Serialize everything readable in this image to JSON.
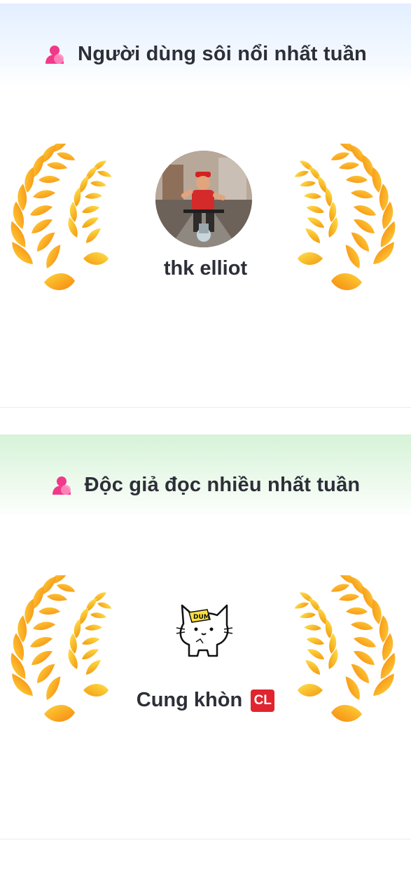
{
  "sections": [
    {
      "title": "Người dùng sôi nổi nhất tuần",
      "icon": "user-icon",
      "winner": {
        "name": "thk elliot",
        "badge": ""
      },
      "accent": "#e3efff"
    },
    {
      "title": "Độc giả đọc nhiều nhất tuần",
      "icon": "user-icon",
      "winner": {
        "name": "Cung khòn",
        "badge": "CL"
      },
      "accent": "#d6f3d8"
    }
  ],
  "colors": {
    "title_text": "#2d2f38",
    "icon_pink": "#f0398a",
    "wreath_gold": "#ffc21a",
    "wreath_orange": "#f57a0c",
    "badge_red": "#e0252f"
  }
}
